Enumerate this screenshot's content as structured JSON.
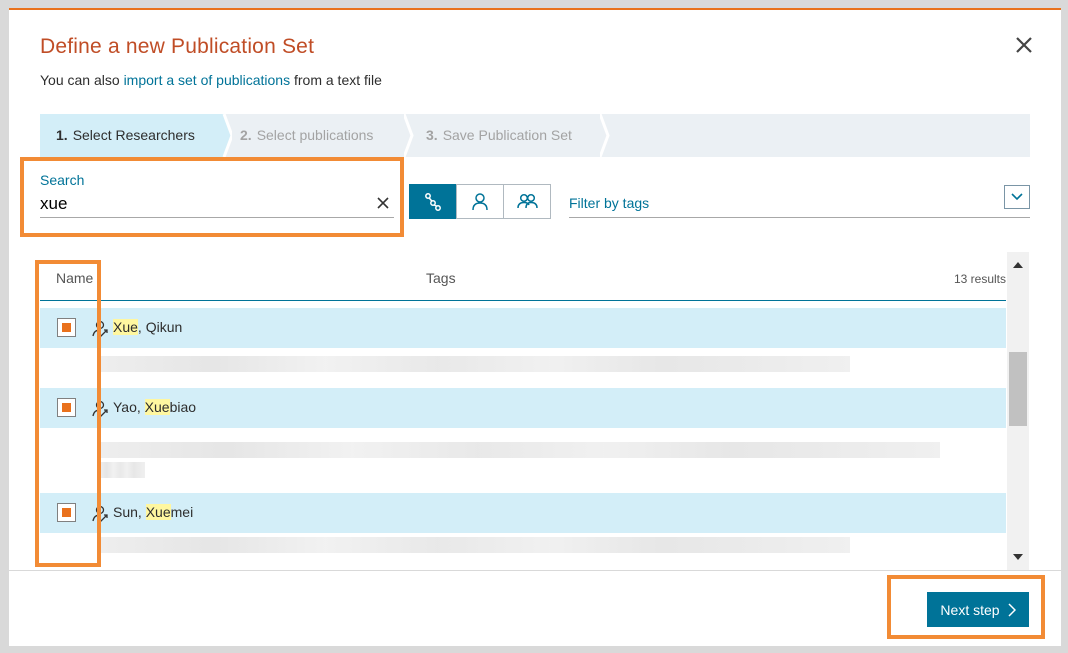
{
  "dialog": {
    "title": "Define a new Publication Set",
    "subtitle_prefix": "You can also ",
    "subtitle_link": "import a set of publications",
    "subtitle_suffix": " from a text file"
  },
  "steps": [
    {
      "num": "1.",
      "label": "Select Researchers",
      "active": true
    },
    {
      "num": "2.",
      "label": "Select publications",
      "active": false
    },
    {
      "num": "3.",
      "label": "Save Publication Set",
      "active": false
    }
  ],
  "search": {
    "label": "Search",
    "value": "xue"
  },
  "view_toggles": [
    {
      "icon": "hierarchy-icon",
      "active": true
    },
    {
      "icon": "person-icon",
      "active": false
    },
    {
      "icon": "group-icon",
      "active": false
    }
  ],
  "filter": {
    "label": "Filter by tags"
  },
  "table": {
    "col_name": "Name",
    "col_tags": "Tags",
    "results": "13 results",
    "rows": [
      {
        "name_highlight": "Xue",
        "name_rest": ", Qikun",
        "name_prefix": "",
        "checked": true
      },
      {
        "name_prefix": "Yao, ",
        "name_highlight": "Xue",
        "name_rest": "biao",
        "checked": true
      },
      {
        "name_prefix": "Sun, ",
        "name_highlight": "Xue",
        "name_rest": "mei",
        "checked": true
      }
    ]
  },
  "footer": {
    "next_label": "Next step"
  },
  "colors": {
    "accent": "#007398",
    "title": "#c04d26",
    "highlight_box": "#f28b35",
    "checkbox": "#e9711c"
  }
}
